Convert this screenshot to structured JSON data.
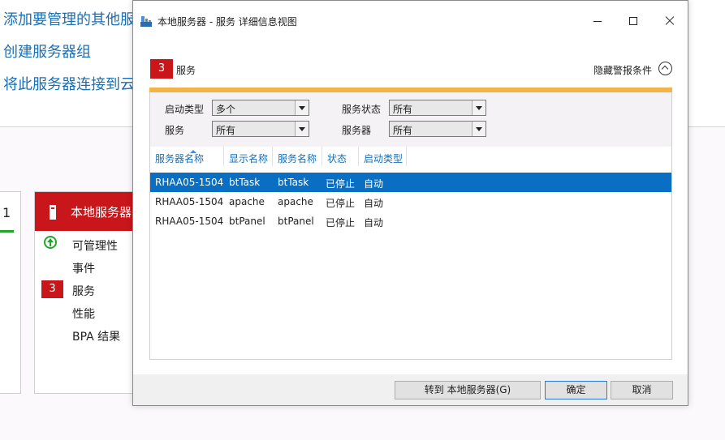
{
  "background": {
    "links": [
      "添加要管理的其他服",
      "创建服务器组",
      "将此服务器连接到云"
    ],
    "left_tile_number": "1",
    "tile": {
      "title": "本地服务器",
      "items": [
        {
          "label": "可管理性"
        },
        {
          "label": "事件"
        },
        {
          "label": "服务",
          "badge": "3"
        },
        {
          "label": "性能"
        },
        {
          "label": "BPA 结果"
        }
      ]
    }
  },
  "dialog": {
    "title": "本地服务器 - 服务 详细信息视图",
    "section": {
      "count": "3",
      "title": "服务"
    },
    "hide_criteria_label": "隐藏警报条件",
    "filters": {
      "startup_type": {
        "label": "启动类型",
        "value": "多个"
      },
      "service_status": {
        "label": "服务状态",
        "value": "所有"
      },
      "service": {
        "label": "服务",
        "value": "所有"
      },
      "server": {
        "label": "服务器",
        "value": "所有"
      }
    },
    "table": {
      "columns": [
        "服务器名称",
        "显示名称",
        "服务名称",
        "状态",
        "启动类型"
      ],
      "rows": [
        [
          "RHAA05-1504",
          "btTask",
          "btTask",
          "已停止",
          "自动"
        ],
        [
          "RHAA05-1504",
          "apache",
          "apache",
          "已停止",
          "自动"
        ],
        [
          "RHAA05-1504",
          "btPanel",
          "btPanel",
          "已停止",
          "自动"
        ]
      ],
      "selected_row": 0
    },
    "buttons": {
      "goto": "转到 本地服务器(G)",
      "ok": "确定",
      "cancel": "取消"
    }
  }
}
